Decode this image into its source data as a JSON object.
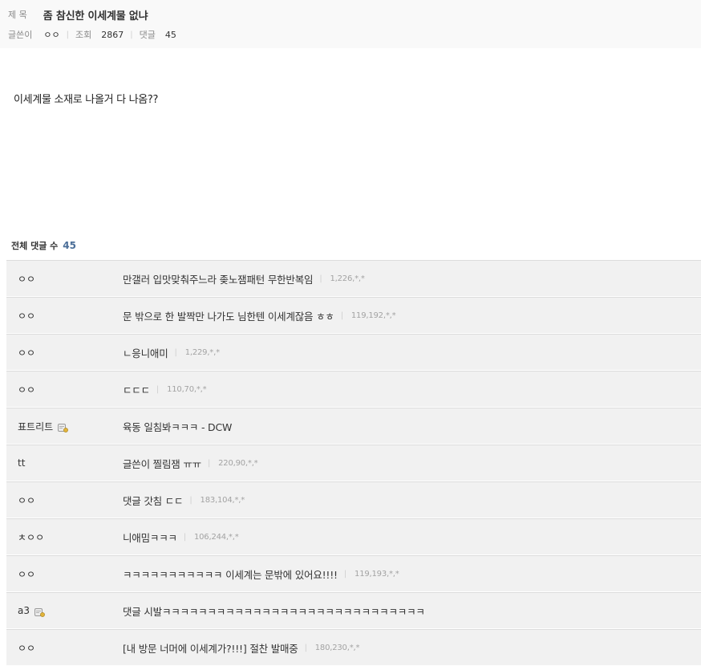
{
  "post": {
    "title_label": "제 목",
    "title": "좀 참신한 이세계물 없냐",
    "author_label": "글쓴이",
    "author": "ㅇㅇ",
    "views_label": "조회",
    "views": "2867",
    "comments_label": "댓글",
    "comments": "45",
    "body": "이세계물 소재로 나올거 다 나옴??"
  },
  "comments_section": {
    "label": "전체 댓글 수",
    "count": "45",
    "items": [
      {
        "name": "ㅇㅇ",
        "text": "만갤러 입맛맞춰주느라 좆노잼패턴 무한반복임",
        "ip": "1,226,*,*",
        "member": false
      },
      {
        "name": "ㅇㅇ",
        "text": "문 밖으로 한 발짝만 나가도 님한텐 이세계잖음 ㅎㅎ",
        "ip": "119,192,*,*",
        "member": false
      },
      {
        "name": "ㅇㅇ",
        "text": "ㄴ응니애미",
        "ip": "1,229,*,*",
        "member": false
      },
      {
        "name": "ㅇㅇ",
        "text": "ㄷㄷㄷ",
        "ip": "110,70,*,*",
        "member": false
      },
      {
        "name": "표트리트",
        "text": "육동 일침봐ㅋㅋㅋ - DCW",
        "ip": "",
        "member": true
      },
      {
        "name": "tt",
        "text": "글쓴이 찔림잼 ㅠㅠ",
        "ip": "220,90,*,*",
        "member": false
      },
      {
        "name": "ㅇㅇ",
        "text": "댓글 갓침 ㄷㄷ",
        "ip": "183,104,*,*",
        "member": false
      },
      {
        "name": "ㅊㅇㅇ",
        "text": "니애밈ㅋㅋㅋ",
        "ip": "106,244,*,*",
        "member": false
      },
      {
        "name": "ㅇㅇ",
        "text": "ㅋㅋㅋㅋㅋㅋㅋㅋㅋㅋㅋ 이세계는 문밖에 있어요!!!!",
        "ip": "119,193,*,*",
        "member": false
      },
      {
        "name": "a3",
        "text": "댓글 시발ㅋㅋㅋㅋㅋㅋㅋㅋㅋㅋㅋㅋㅋㅋㅋㅋㅋㅋㅋㅋㅋㅋㅋㅋㅋㅋㅋㅋㅋ",
        "ip": "",
        "member": true
      },
      {
        "name": "ㅇㅇ",
        "text": "[내 방문 너머에 이세계가?!!!] 절찬 발매중",
        "ip": "180,230,*,*",
        "member": false
      }
    ]
  },
  "colors": {
    "header_bg": "#f9f9f9",
    "comment_bg": "#f1f1f1",
    "count_accent": "#4b6e98",
    "ip_gray": "#a3a3a3"
  },
  "icons": {
    "member": "member-badge-icon"
  }
}
